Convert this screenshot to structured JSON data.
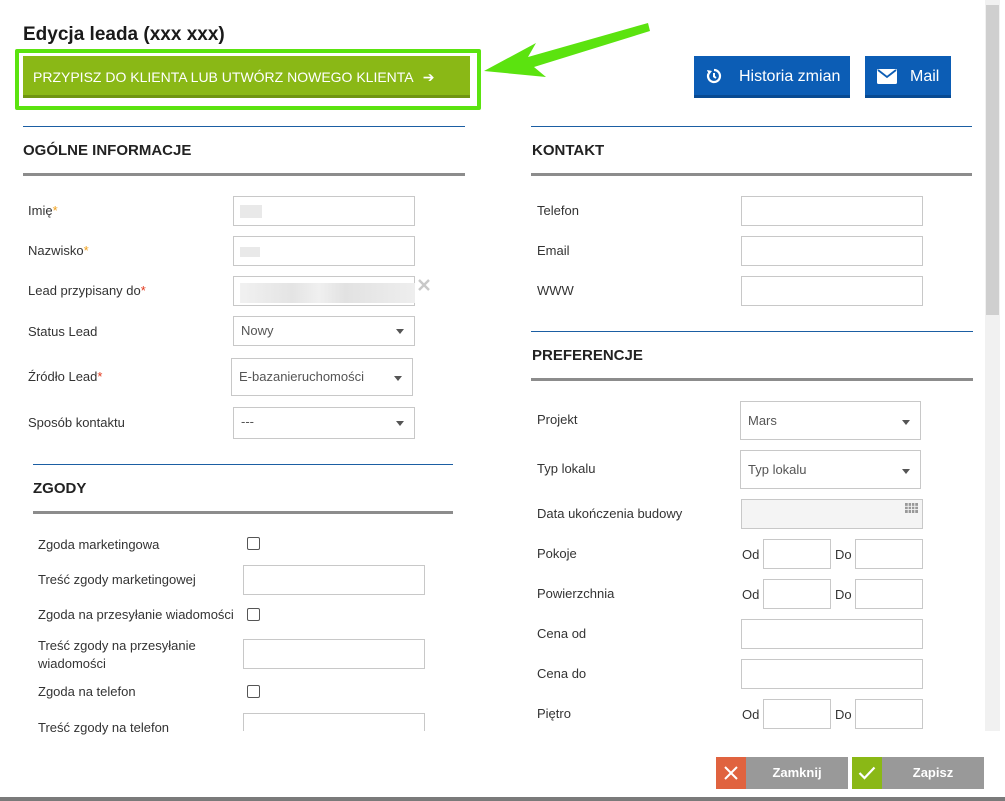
{
  "title": "Edycja leada (xxx xxx)",
  "assign_button": "PRZYPISZ DO KLIENTA LUB UTWÓRZ NOWEGO KLIENTA",
  "history_button": "Historia zmian",
  "mail_button": "Mail",
  "general": {
    "title": "OGÓLNE INFORMACJE",
    "first_name_label": "Imię",
    "last_name_label": "Nazwisko",
    "assigned_label": "Lead przypisany do",
    "status_label": "Status Lead",
    "status_value": "Nowy",
    "source_label": "Źródło Lead",
    "source_value": "E-bazanieruchomości",
    "contact_method_label": "Sposób kontaktu",
    "contact_method_value": "---",
    "required_mark": "*"
  },
  "consents": {
    "title": "ZGODY",
    "marketing_label": "Zgoda marketingowa",
    "marketing_text_label": "Treść zgody marketingowej",
    "messages_label": "Zgoda na przesyłanie wiadomości",
    "messages_text_label": "Treść zgody na przesyłanie wiadomości",
    "phone_label": "Zgoda na telefon",
    "phone_text_label": "Treść zgody na telefon"
  },
  "contact": {
    "title": "KONTAKT",
    "phone_label": "Telefon",
    "email_label": "Email",
    "www_label": "WWW"
  },
  "preferences": {
    "title": "PREFERENCJE",
    "project_label": "Projekt",
    "project_value": "Mars",
    "unit_type_label": "Typ lokalu",
    "unit_type_value": "Typ lokalu",
    "completion_label": "Data ukończenia budowy",
    "rooms_label": "Pokoje",
    "area_label": "Powierzchnia",
    "price_from_label": "Cena od",
    "price_to_label": "Cena do",
    "floor_label": "Piętro",
    "from_label": "Od",
    "to_label": "Do"
  },
  "footer": {
    "close_label": "Zamknij",
    "save_label": "Zapisz"
  },
  "colors": {
    "primary": "#0c5db5",
    "assign": "#8ab816",
    "highlight": "#5be30f",
    "danger": "#e0633f"
  }
}
